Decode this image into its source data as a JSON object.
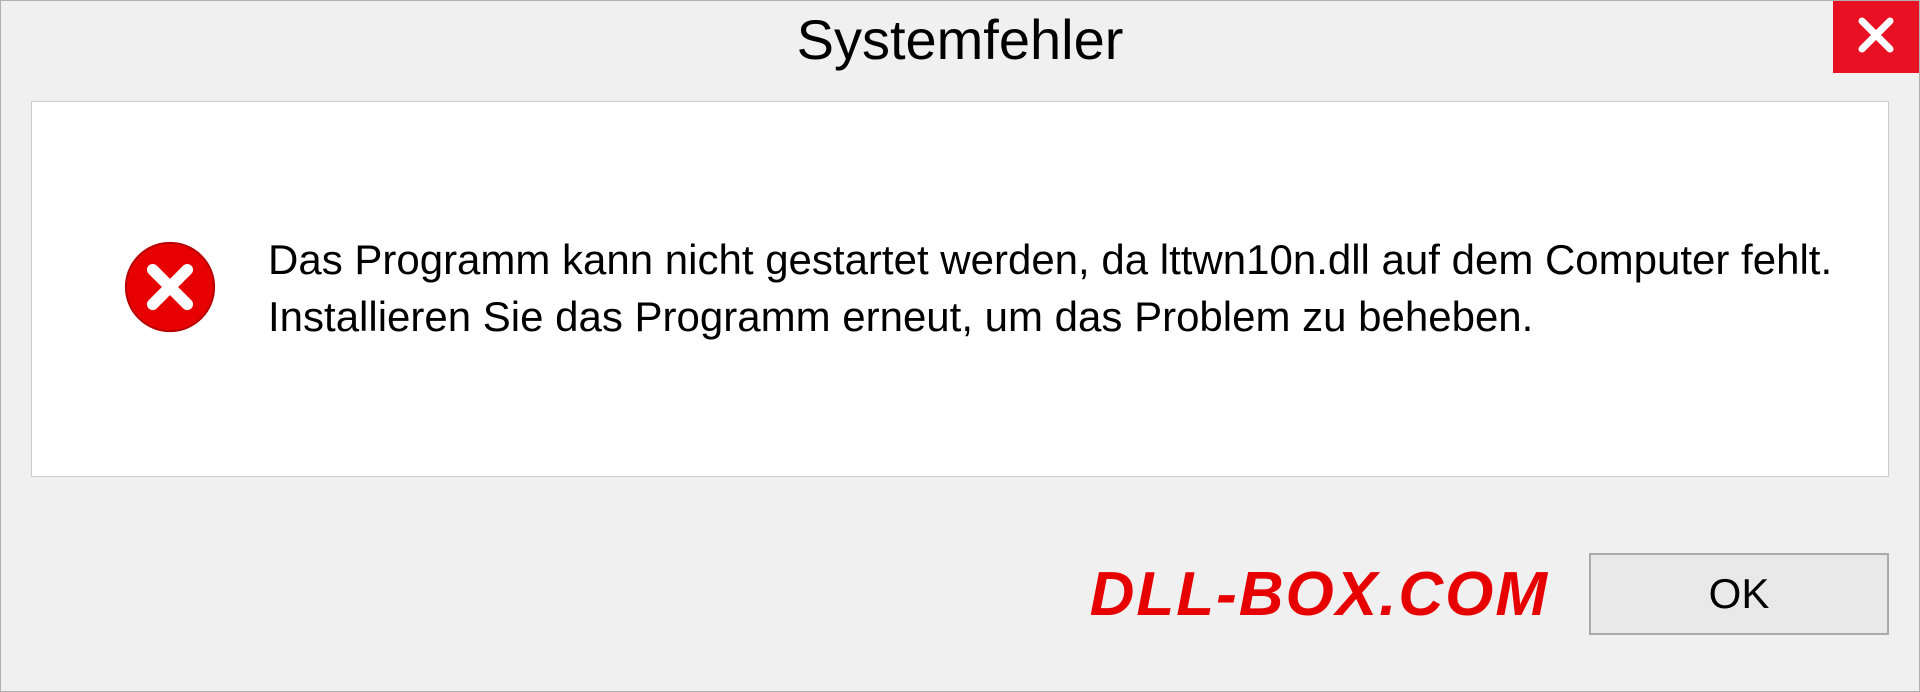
{
  "dialog": {
    "title": "Systemfehler",
    "message": "Das Programm kann nicht gestartet werden, da lttwn10n.dll auf dem Computer fehlt. Installieren Sie das Programm erneut, um das Problem zu beheben.",
    "ok_label": "OK"
  },
  "watermark": "DLL-BOX.COM"
}
